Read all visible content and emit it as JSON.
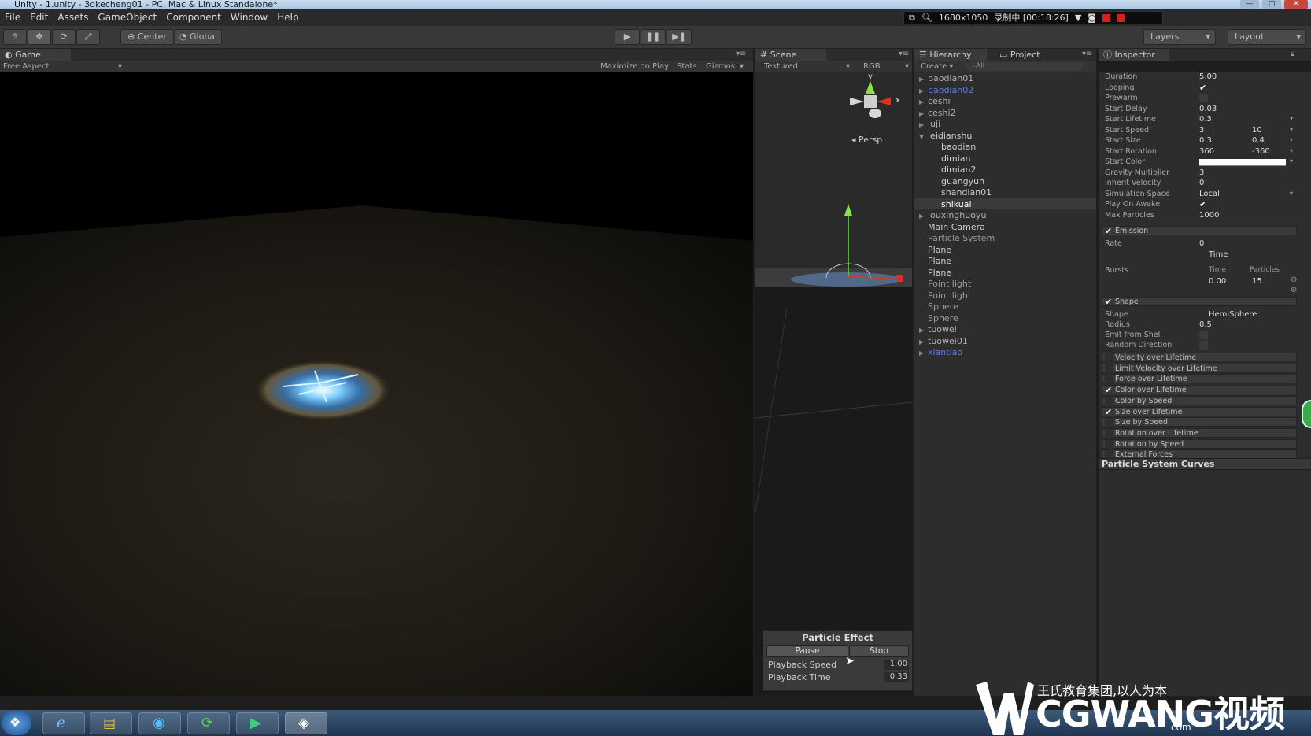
{
  "window": {
    "title": "Unity - 1.unity - 3dkecheng01 - PC, Mac & Linux Standalone*"
  },
  "menu": [
    "File",
    "Edit",
    "Assets",
    "GameObject",
    "Component",
    "Window",
    "Help"
  ],
  "recorder": {
    "resolution": "1680x1050",
    "status": "录制中 [00:18:26]"
  },
  "toolbar": {
    "center": "Center",
    "global": "Global",
    "layers": "Layers",
    "layout": "Layout"
  },
  "game": {
    "tab": "Game",
    "aspect": "Free Aspect",
    "maximize": "Maximize on Play",
    "stats": "Stats",
    "gizmos": "Gizmos"
  },
  "scene": {
    "tab": "Scene",
    "mode": "Textured",
    "rgb": "RGB",
    "persp": "Persp",
    "axis_y": "y",
    "axis_x": "x"
  },
  "hierarchy": {
    "tab": "Hierarchy",
    "project_tab": "Project",
    "create": "Create",
    "search": "All",
    "items": [
      {
        "label": "baodian01",
        "indent": 0,
        "arrow": "▶",
        "color": "#b0b0b0"
      },
      {
        "label": "baodian02",
        "indent": 0,
        "arrow": "▶",
        "color": "#5c7fd6"
      },
      {
        "label": "ceshi",
        "indent": 0,
        "arrow": "▶",
        "color": "#b0b0b0"
      },
      {
        "label": "ceshi2",
        "indent": 0,
        "arrow": "▶",
        "color": "#b0b0b0"
      },
      {
        "label": "juji",
        "indent": 0,
        "arrow": "▶",
        "color": "#b0b0b0"
      },
      {
        "label": "leidianshu",
        "indent": 0,
        "arrow": "▼",
        "color": "#cfcfcf"
      },
      {
        "label": "baodian",
        "indent": 1,
        "arrow": "",
        "color": "#cfcfcf"
      },
      {
        "label": "dimian",
        "indent": 1,
        "arrow": "",
        "color": "#cfcfcf"
      },
      {
        "label": "dimian2",
        "indent": 1,
        "arrow": "",
        "color": "#cfcfcf"
      },
      {
        "label": "guangyun",
        "indent": 1,
        "arrow": "",
        "color": "#cfcfcf"
      },
      {
        "label": "shandian01",
        "indent": 1,
        "arrow": "",
        "color": "#cfcfcf"
      },
      {
        "label": "shikuai",
        "indent": 1,
        "arrow": "",
        "color": "#ffffff",
        "selected": true
      },
      {
        "label": "louxinghuoyu",
        "indent": 0,
        "arrow": "▶",
        "color": "#b0b0b0"
      },
      {
        "label": "Main Camera",
        "indent": 0,
        "arrow": "",
        "color": "#cfcfcf"
      },
      {
        "label": "Particle System",
        "indent": 0,
        "arrow": "",
        "color": "#9a9a9a"
      },
      {
        "label": "Plane",
        "indent": 0,
        "arrow": "",
        "color": "#cfcfcf"
      },
      {
        "label": "Plane",
        "indent": 0,
        "arrow": "",
        "color": "#cfcfcf"
      },
      {
        "label": "Plane",
        "indent": 0,
        "arrow": "",
        "color": "#cfcfcf"
      },
      {
        "label": "Point light",
        "indent": 0,
        "arrow": "",
        "color": "#9a9a9a"
      },
      {
        "label": "Point light",
        "indent": 0,
        "arrow": "",
        "color": "#9a9a9a"
      },
      {
        "label": "Sphere",
        "indent": 0,
        "arrow": "",
        "color": "#9a9a9a"
      },
      {
        "label": "Sphere",
        "indent": 0,
        "arrow": "",
        "color": "#9a9a9a"
      },
      {
        "label": "tuowei",
        "indent": 0,
        "arrow": "▶",
        "color": "#b0b0b0"
      },
      {
        "label": "tuowei01",
        "indent": 0,
        "arrow": "▶",
        "color": "#b0b0b0"
      },
      {
        "label": "xiantiao",
        "indent": 0,
        "arrow": "▶",
        "color": "#5c7fd6"
      }
    ]
  },
  "inspector": {
    "tab": "Inspector",
    "props": [
      {
        "label": "Duration",
        "value": "5.00",
        "value2": ""
      },
      {
        "label": "Looping",
        "value": "✔",
        "value2": ""
      },
      {
        "label": "Prewarm",
        "value": "",
        "value2": ""
      },
      {
        "label": "Start Delay",
        "value": "0.03",
        "value2": ""
      },
      {
        "label": "Start Lifetime",
        "value": "0.3",
        "value2": ""
      },
      {
        "label": "Start Speed",
        "value": "3",
        "value2": "10"
      },
      {
        "label": "Start Size",
        "value": "0.3",
        "value2": "0.4"
      },
      {
        "label": "Start Rotation",
        "value": "360",
        "value2": "-360"
      },
      {
        "label": "Start Color",
        "value": "",
        "value2": ""
      },
      {
        "label": "Gravity Multiplier",
        "value": "3",
        "value2": ""
      },
      {
        "label": "Inherit Velocity",
        "value": "0",
        "value2": ""
      },
      {
        "label": "Simulation Space",
        "value": "Local",
        "value2": ""
      },
      {
        "label": "Play On Awake",
        "value": "✔",
        "value2": ""
      },
      {
        "label": "Max Particles",
        "value": "1000",
        "value2": ""
      }
    ],
    "emission": {
      "header": "Emission",
      "rate_label": "Rate",
      "rate_value": "0",
      "rate_mode": "Time",
      "bursts_label": "Bursts",
      "col_time": "Time",
      "col_particles": "Particles",
      "burst_time": "0.00",
      "burst_particles": "15"
    },
    "shape": {
      "header": "Shape",
      "shape_label": "Shape",
      "shape_value": "HemiSphere",
      "radius_label": "Radius",
      "radius_value": "0.5",
      "emit_shell": "Emit from Shell",
      "random_dir": "Random Direction"
    },
    "modules": [
      {
        "label": "Velocity over Lifetime",
        "checked": false
      },
      {
        "label": "Limit Velocity over Lifetime",
        "checked": false
      },
      {
        "label": "Force over Lifetime",
        "checked": false
      },
      {
        "label": "Color over Lifetime",
        "checked": true
      },
      {
        "label": "Color by Speed",
        "checked": false
      },
      {
        "label": "Size over Lifetime",
        "checked": true
      },
      {
        "label": "Size by Speed",
        "checked": false
      },
      {
        "label": "Rotation over Lifetime",
        "checked": false
      },
      {
        "label": "Rotation by Speed",
        "checked": false
      },
      {
        "label": "External Forces",
        "checked": false
      }
    ],
    "curves_title": "Particle System Curves"
  },
  "particle_effect": {
    "title": "Particle Effect",
    "pause": "Pause",
    "stop": "Stop",
    "speed_label": "Playback Speed",
    "speed_value": "1.00",
    "time_label": "Playback Time",
    "time_value": "0.33"
  },
  "watermark": {
    "slogan": "王氏教育集团,以人为本",
    "brand": "CGWANG视频",
    "com": "com"
  },
  "colors": {
    "accent": "#3b6fd6",
    "selected": "#3d5a8f",
    "record": "#d62020"
  }
}
